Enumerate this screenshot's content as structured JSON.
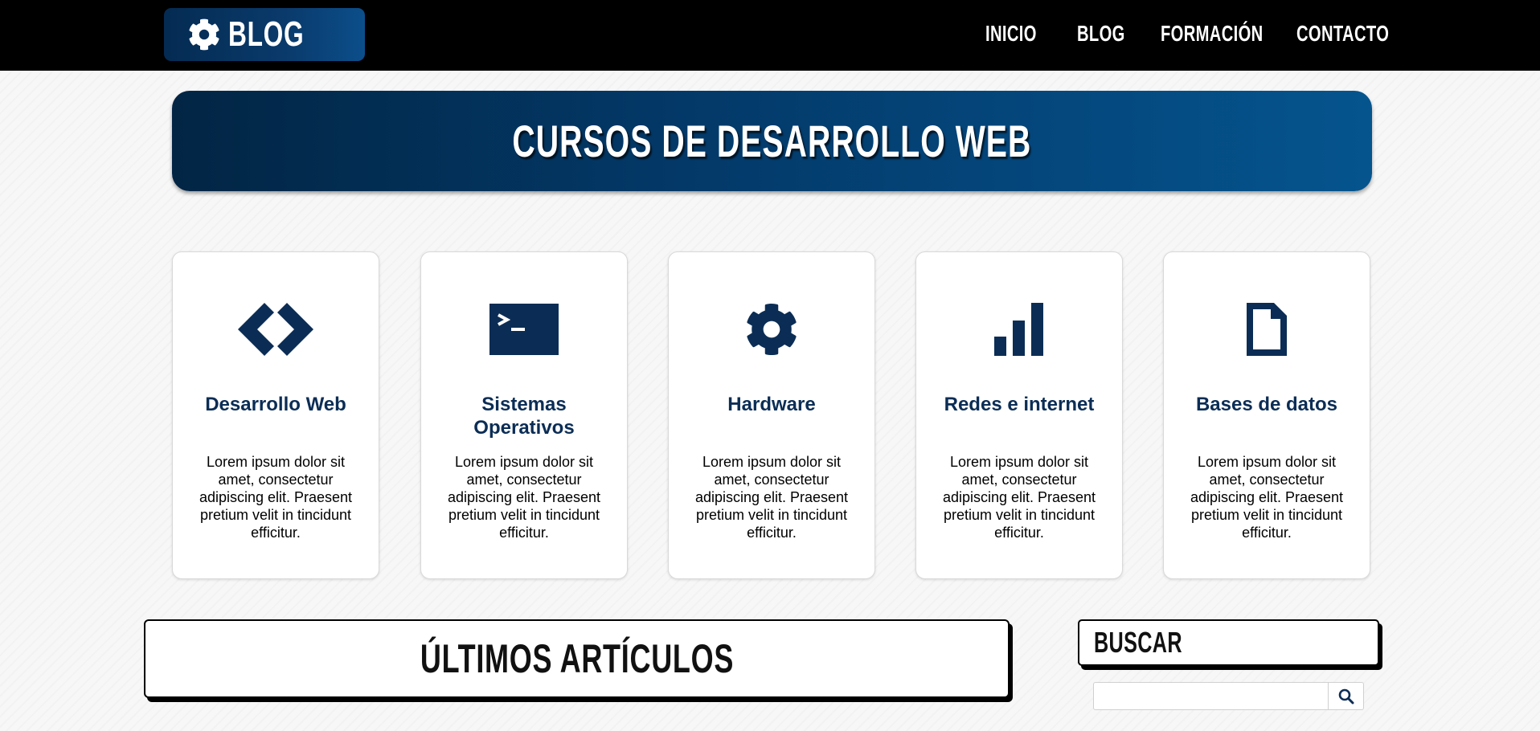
{
  "brand": {
    "text": "BLOG",
    "icon": "gear-icon"
  },
  "nav": [
    {
      "label": "INICIO"
    },
    {
      "label": "BLOG"
    },
    {
      "label": "FORMACIÓN"
    },
    {
      "label": "CONTACTO"
    }
  ],
  "hero": {
    "title": "CURSOS DE DESARROLLO WEB"
  },
  "cards": [
    {
      "icon": "code-icon",
      "title": "Desarrollo Web",
      "text": "Lorem ipsum dolor sit amet, consectetur adipiscing elit. Praesent pretium velit in tincidunt efficitur."
    },
    {
      "icon": "terminal-icon",
      "title": "Sistemas Operativos",
      "text": "Lorem ipsum dolor sit amet, consectetur adipiscing elit. Praesent pretium velit in tincidunt efficitur."
    },
    {
      "icon": "gear-icon",
      "title": "Hardware",
      "text": "Lorem ipsum dolor sit amet, consectetur adipiscing elit. Praesent pretium velit in tincidunt efficitur."
    },
    {
      "icon": "signal-bars-icon",
      "title": "Redes e internet",
      "text": "Lorem ipsum dolor sit amet, consectetur adipiscing elit. Praesent pretium velit in tincidunt efficitur."
    },
    {
      "icon": "document-icon",
      "title": "Bases de datos",
      "text": "Lorem ipsum dolor sit amet, consectetur adipiscing elit. Praesent pretium velit in tincidunt efficitur."
    }
  ],
  "articles": {
    "title": "ÚLTIMOS ARTÍCULOS"
  },
  "search": {
    "title": "BUSCAR",
    "value": "",
    "placeholder": "",
    "icon": "search-icon"
  },
  "colors": {
    "brand_dark": "#022544",
    "brand_light": "#05548e",
    "icon": "#0b2d55",
    "header_bg": "#000000"
  }
}
